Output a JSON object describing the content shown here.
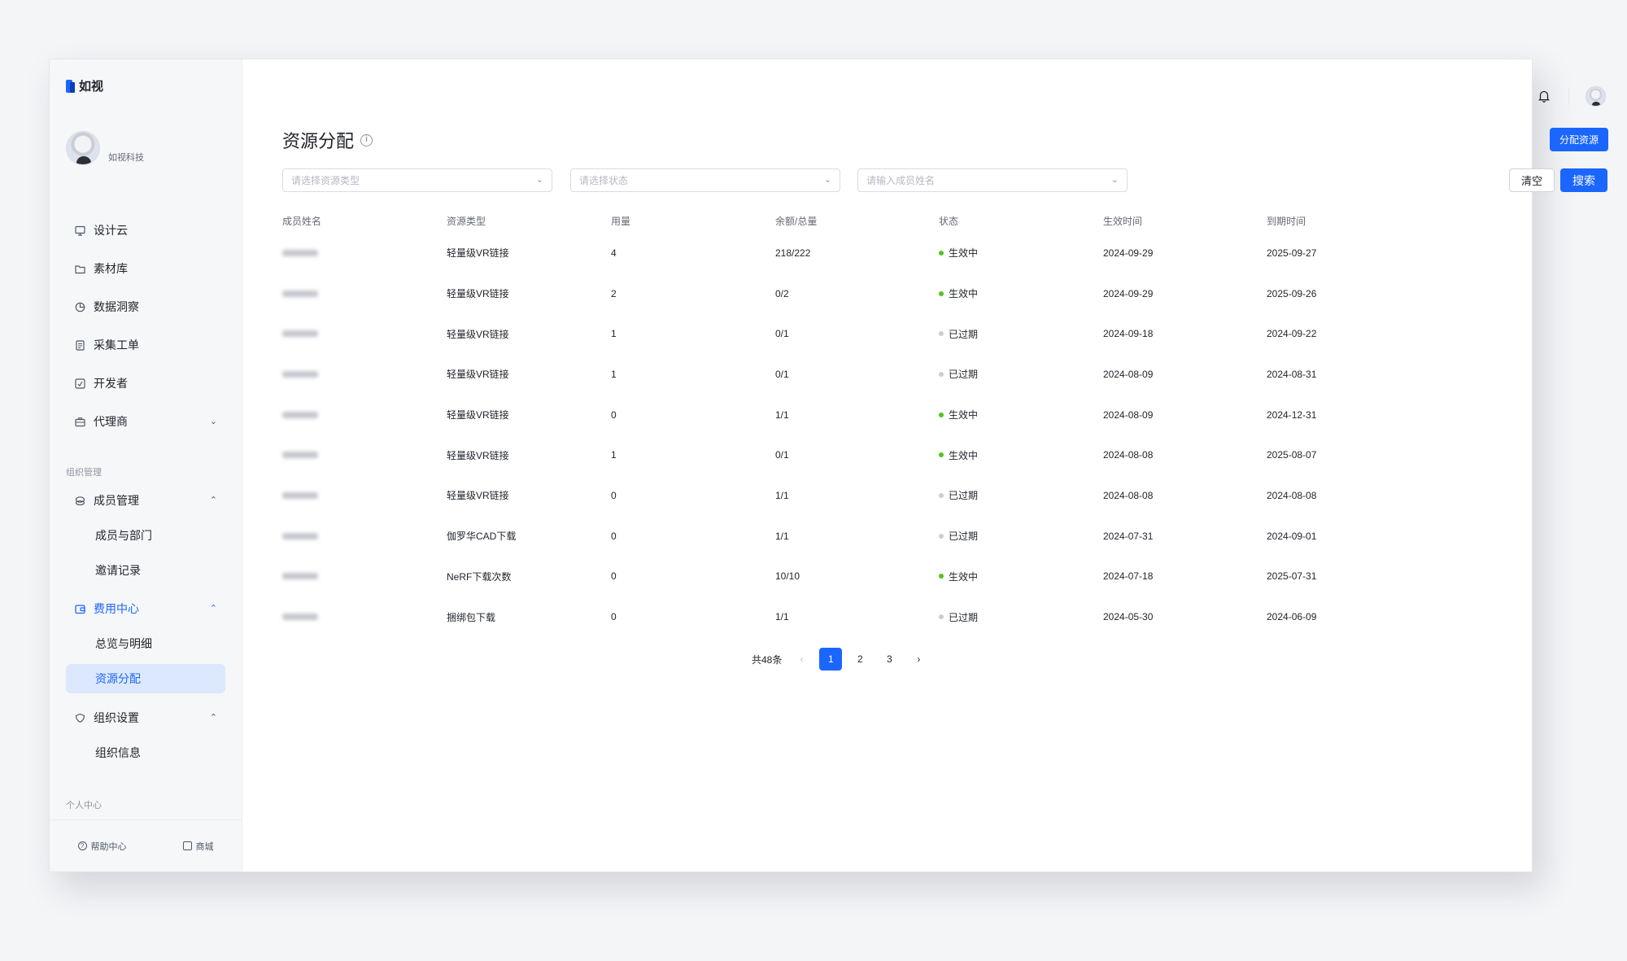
{
  "app": {
    "name": "如视"
  },
  "org": {
    "name": "如视科技"
  },
  "sidebar": {
    "items": [
      {
        "label": "设计云",
        "icon": "monitor-icon"
      },
      {
        "label": "素材库",
        "icon": "folder-icon"
      },
      {
        "label": "数据洞察",
        "icon": "pie-chart-icon"
      },
      {
        "label": "采集工单",
        "icon": "document-icon"
      },
      {
        "label": "开发者",
        "icon": "code-icon"
      },
      {
        "label": "代理商",
        "icon": "briefcase-icon"
      }
    ],
    "section_org": "组织管理",
    "member_mgmt": {
      "label": "成员管理",
      "icon": "users-icon",
      "sub": [
        "成员与部门",
        "邀请记录"
      ]
    },
    "billing": {
      "label": "费用中心",
      "icon": "wallet-icon",
      "sub": [
        "总览与明细",
        "资源分配"
      ]
    },
    "org_settings": {
      "label": "组织设置",
      "icon": "shield-icon",
      "sub": [
        "组织信息"
      ]
    },
    "section_personal": "个人中心",
    "bottom": {
      "help": "帮助中心",
      "store": "商城"
    }
  },
  "page": {
    "title": "资源分配",
    "allocate_button": "分配资源",
    "filters": {
      "resource_type_placeholder": "请选择资源类型",
      "status_placeholder": "请选择状态",
      "member_placeholder": "请输入成员姓名"
    },
    "clear_button": "清空",
    "search_button": "搜索"
  },
  "table": {
    "columns": [
      "成员姓名",
      "资源类型",
      "用量",
      "余额/总量",
      "状态",
      "生效时间",
      "到期时间"
    ],
    "rows": [
      {
        "type": "轻量级VR链接",
        "usage": "4",
        "balance": "218/222",
        "status": "生效中",
        "start": "2024-09-29",
        "end": "2025-09-27"
      },
      {
        "type": "轻量级VR链接",
        "usage": "2",
        "balance": "0/2",
        "status": "生效中",
        "start": "2024-09-29",
        "end": "2025-09-26"
      },
      {
        "type": "轻量级VR链接",
        "usage": "1",
        "balance": "0/1",
        "status": "已过期",
        "start": "2024-09-18",
        "end": "2024-09-22"
      },
      {
        "type": "轻量级VR链接",
        "usage": "1",
        "balance": "0/1",
        "status": "已过期",
        "start": "2024-08-09",
        "end": "2024-08-31"
      },
      {
        "type": "轻量级VR链接",
        "usage": "0",
        "balance": "1/1",
        "status": "生效中",
        "start": "2024-08-09",
        "end": "2024-12-31"
      },
      {
        "type": "轻量级VR链接",
        "usage": "1",
        "balance": "0/1",
        "status": "生效中",
        "start": "2024-08-08",
        "end": "2025-08-07"
      },
      {
        "type": "轻量级VR链接",
        "usage": "0",
        "balance": "1/1",
        "status": "已过期",
        "start": "2024-08-08",
        "end": "2024-08-08"
      },
      {
        "type": "伽罗华CAD下载",
        "usage": "0",
        "balance": "1/1",
        "status": "已过期",
        "start": "2024-07-31",
        "end": "2024-09-01"
      },
      {
        "type": "NeRF下载次数",
        "usage": "0",
        "balance": "10/10",
        "status": "生效中",
        "start": "2024-07-18",
        "end": "2025-07-31"
      },
      {
        "type": "捆绑包下载",
        "usage": "0",
        "balance": "1/1",
        "status": "已过期",
        "start": "2024-05-30",
        "end": "2024-06-09"
      }
    ]
  },
  "pagination": {
    "total": "共48条",
    "pages": [
      "1",
      "2",
      "3"
    ],
    "current": "1",
    "prev": "‹",
    "next": "›"
  },
  "colors": {
    "primary": "#1a66ff",
    "active": "#52c41a",
    "expired": "#c9cdd4"
  }
}
